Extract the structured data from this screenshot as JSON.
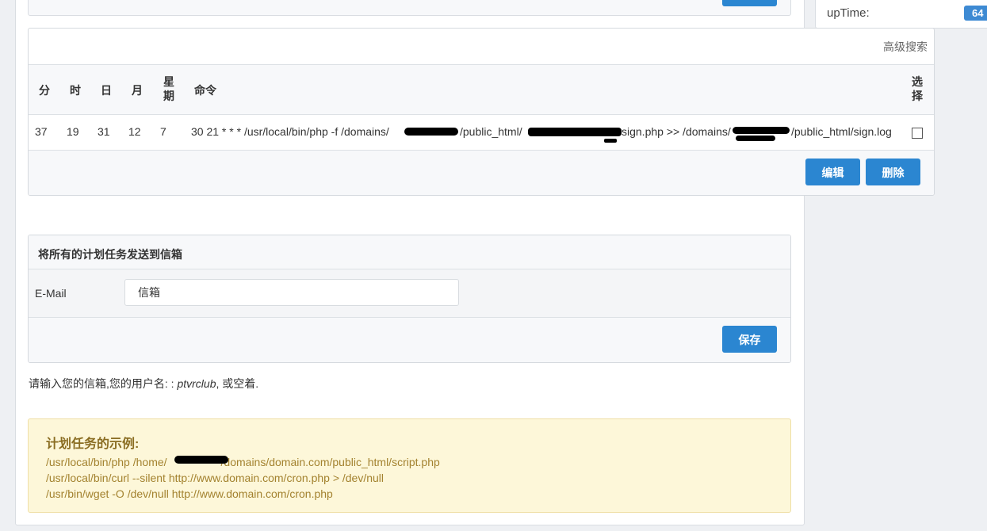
{
  "sidebar": {
    "uptime_label": "upTime:",
    "uptime_value": "64"
  },
  "cron_table": {
    "advanced_search": "高级搜索",
    "headers": {
      "minute": "分",
      "hour": "时",
      "day": "日",
      "month": "月",
      "weekday_1": "星",
      "weekday_2": "期",
      "command": "命令",
      "select_1": "选",
      "select_2": "择"
    },
    "rows": [
      {
        "minute": "37",
        "hour": "19",
        "day": "31",
        "month": "12",
        "weekday": "7",
        "command_part1": "30 21 * * * /usr/local/bin/php -f /domains/",
        "command_part2": "/public_html/",
        "command_part3": "sign.php >> /domains/",
        "command_part4": "/public_html/sign.log"
      }
    ],
    "edit_button": "编辑",
    "delete_button": "删除"
  },
  "email_section": {
    "title": "将所有的计划任务发送到信箱",
    "label": "E-Mail",
    "input_value": "信箱",
    "save_button": "保存"
  },
  "hint": {
    "prefix": "请输入您的信箱,您的用户名: : ",
    "username": "ptvrclub",
    "suffix": ", 或空着."
  },
  "examples": {
    "title": "计划任务的示例:",
    "line1_a": "/usr/local/bin/php /home/",
    "line1_b": "/domains/domain.com/public_html/script.php",
    "line2": "/usr/local/bin/curl --silent http://www.domain.com/cron.php > /dev/null",
    "line3": "/usr/bin/wget -O /dev/null http://www.domain.com/cron.php"
  }
}
